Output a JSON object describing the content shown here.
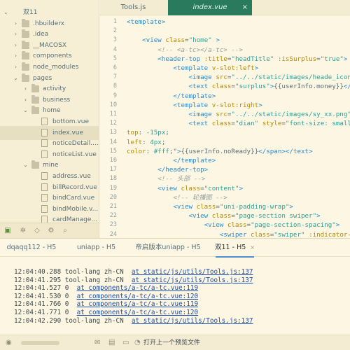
{
  "sidebar": {
    "project": "双11",
    "items": [
      {
        "label": "双11",
        "kind": "project",
        "chev": "⌄",
        "depth": 0
      },
      {
        "label": ".hbuilderx",
        "kind": "folder",
        "chev": "›",
        "depth": 1
      },
      {
        "label": ".idea",
        "kind": "folder",
        "chev": "›",
        "depth": 1
      },
      {
        "label": "__MACOSX",
        "kind": "folder",
        "chev": "›",
        "depth": 1
      },
      {
        "label": "components",
        "kind": "folder",
        "chev": "›",
        "depth": 1
      },
      {
        "label": "node_modules",
        "kind": "folder",
        "chev": "›",
        "depth": 1
      },
      {
        "label": "pages",
        "kind": "folder",
        "chev": "⌄",
        "depth": 1
      },
      {
        "label": "activity",
        "kind": "folder",
        "chev": "›",
        "depth": 2
      },
      {
        "label": "business",
        "kind": "folder",
        "chev": "›",
        "depth": 2
      },
      {
        "label": "home",
        "kind": "folder",
        "chev": "⌄",
        "depth": 2
      },
      {
        "label": "bottom.vue",
        "kind": "file",
        "chev": "",
        "depth": 3
      },
      {
        "label": "index.vue",
        "kind": "file",
        "chev": "",
        "depth": 3,
        "selected": true
      },
      {
        "label": "noticeDetail....",
        "kind": "file",
        "chev": "",
        "depth": 3
      },
      {
        "label": "noticeList.vue",
        "kind": "file",
        "chev": "",
        "depth": 3
      },
      {
        "label": "mine",
        "kind": "folder",
        "chev": "⌄",
        "depth": 2
      },
      {
        "label": "address.vue",
        "kind": "file",
        "chev": "",
        "depth": 3
      },
      {
        "label": "billRecord.vue",
        "kind": "file",
        "chev": "",
        "depth": 3
      },
      {
        "label": "bindCard.vue",
        "kind": "file",
        "chev": "",
        "depth": 3
      },
      {
        "label": "bindMobile.v...",
        "kind": "file",
        "chev": "",
        "depth": 3
      },
      {
        "label": "cardManage...",
        "kind": "file",
        "chev": "",
        "depth": 3
      }
    ]
  },
  "tabs": [
    {
      "label": "Tools.js",
      "active": false
    },
    {
      "label": "index.vue",
      "active": true,
      "close": "×"
    }
  ],
  "editor": {
    "lines": [
      {
        "n": "1",
        "html": "<span class='tg'>&lt;template&gt;</span>"
      },
      {
        "n": "2",
        "html": ""
      },
      {
        "n": "3",
        "html": "    <span class='tg'>&lt;view</span> <span class='at'>class</span>=<span class='st'>\"home\"</span> <span class='tg'>&gt;</span>"
      },
      {
        "n": "4",
        "html": "        <span class='cm'>&lt;!-- &lt;a-tc&gt;&lt;/a-tc&gt; --&gt;</span>"
      },
      {
        "n": "5",
        "html": "        <span class='tg'>&lt;header-top</span> <span class='at'>:title</span>=<span class='st'>\"headTitle\"</span> <span class='at'>:isSurplus</span>=<span class='st'>\"true\"</span><span class='tg'>&gt;</span>"
      },
      {
        "n": "6",
        "html": "            <span class='tg'>&lt;template</span> <span class='at'>v-slot:left</span><span class='tg'>&gt;</span>"
      },
      {
        "n": "7",
        "html": "                <span class='tg'>&lt;image</span> <span class='at'>src</span>=<span class='st'>\"../../static/images/heade_icon</span>"
      },
      {
        "n": "8",
        "html": "                <span class='tg'>&lt;text</span> <span class='at'>class</span>=<span class='st'>\"surplus\"</span><span class='tg'>&gt;</span><span class='pl'>{{userInfo.money}}</span><span class='tg'>&lt;/</span>"
      },
      {
        "n": "9",
        "html": "            <span class='tg'>&lt;/template&gt;</span>"
      },
      {
        "n": "10",
        "html": "            <span class='tg'>&lt;template</span> <span class='at'>v-slot:right</span><span class='tg'>&gt;</span>"
      },
      {
        "n": "11",
        "html": "                <span class='tg'>&lt;image</span> <span class='at'>src</span>=<span class='st'>\"../../static/images/sy_xx.png\"</span>"
      },
      {
        "n": "12",
        "html": "                <span class='tg'>&lt;text</span> <span class='at'>class</span>=<span class='st'>\"dian\"</span> <span class='at'>style</span>=<span class='st'>\"font-size: small</span>"
      },
      {
        "n": "13",
        "html": "<span class='at'>top</span>: <span class='st'>-15px</span>;"
      },
      {
        "n": "14",
        "html": "<span class='at'>left</span>: <span class='st'>4px</span>;"
      },
      {
        "n": "15",
        "html": "<span class='at'>color</span>: <span class='st'>#fff</span>;\"<span class='tg'>&gt;</span><span class='pl'>{{userInfo.noReady}}</span><span class='tg'>&lt;/span&gt;&lt;/text&gt;</span>"
      },
      {
        "n": "16",
        "html": "            <span class='tg'>&lt;/template&gt;</span>"
      },
      {
        "n": "17",
        "html": "        <span class='tg'>&lt;/header-top&gt;</span>"
      },
      {
        "n": "18",
        "html": "        <span class='cm'>&lt;!-- 头部 --&gt;</span>"
      },
      {
        "n": "19",
        "html": "        <span class='tg'>&lt;view</span> <span class='at'>class</span>=<span class='st'>\"content\"</span><span class='tg'>&gt;</span>"
      },
      {
        "n": "20",
        "html": "            <span class='cm'>&lt;!-- 轮播图 --&gt;</span>"
      },
      {
        "n": "21",
        "html": "            <span class='tg'>&lt;view</span> <span class='at'>class</span>=<span class='st'>\"uni-padding-wrap\"</span><span class='tg'>&gt;</span>"
      },
      {
        "n": "22",
        "html": "                <span class='tg'>&lt;view</span> <span class='at'>class</span>=<span class='st'>\"page-section swiper\"</span><span class='tg'>&gt;</span>"
      },
      {
        "n": "23",
        "html": "                    <span class='tg'>&lt;view</span> <span class='at'>class</span>=<span class='st'>\"page-section-spacing\"</span><span class='tg'>&gt;</span>"
      },
      {
        "n": "24",
        "html": "                        <span class='tg'>&lt;swiper</span> <span class='at'>class</span>=<span class='st'>\"swiper\"</span> <span class='at'>:indicator-</span>"
      }
    ]
  },
  "console": {
    "tabs": [
      {
        "label": "dqaqq112 - H5",
        "active": false
      },
      {
        "label": "uniapp - H5",
        "active": false
      },
      {
        "label": "帝启版本uniapp - H5",
        "active": false
      },
      {
        "label": "双11 - H5",
        "active": true,
        "close": "×"
      }
    ],
    "logs": [
      {
        "prefix": "12:04:40.288 tool-lang zh-CN  ",
        "link": "at static/js/utils/Tools.js:137"
      },
      {
        "prefix": "12:04:41.295 tool-lang zh-CN  ",
        "link": "at static/js/utils/Tools.js:137"
      },
      {
        "prefix": "12:04:41.527 0  ",
        "link": "at components/a-tc/a-tc.vue:119"
      },
      {
        "prefix": "12:04:41.530 0  ",
        "link": "at components/a-tc/a-tc.vue:120"
      },
      {
        "prefix": "12:04:41.766 0  ",
        "link": "at components/a-tc/a-tc.vue:119"
      },
      {
        "prefix": "12:04:41.771 0  ",
        "link": "at components/a-tc/a-tc.vue:120"
      },
      {
        "prefix": "12:04:42.290 tool-lang zh-CN  ",
        "link": "at static/js/utils/Tools.js:137"
      }
    ]
  },
  "status": {
    "message": "打开上一个预览文件"
  }
}
